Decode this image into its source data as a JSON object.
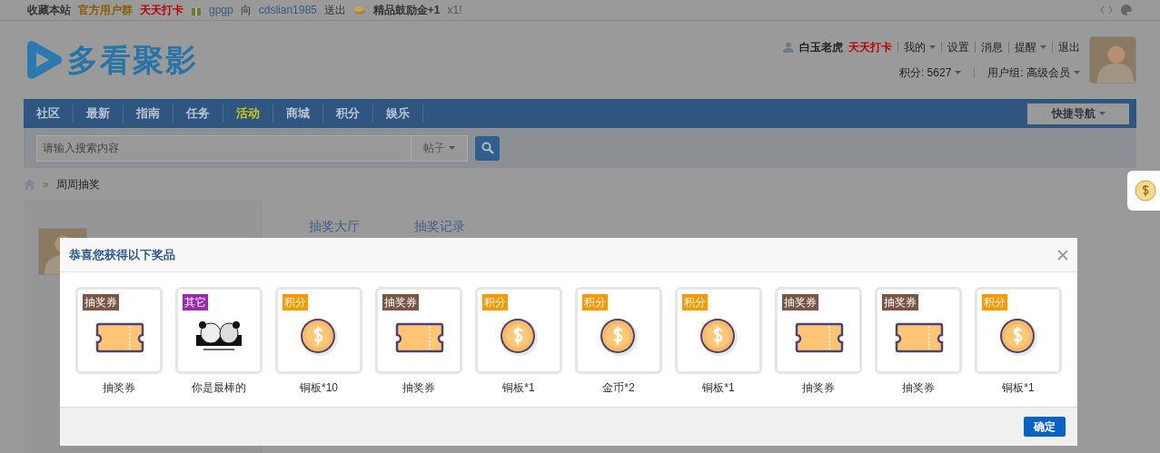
{
  "top_bar": {
    "items": [
      {
        "text": "收藏本站",
        "kind": "plain"
      },
      {
        "text": "官方用户群",
        "kind": "orange"
      },
      {
        "text": "天天打卡",
        "kind": "red"
      }
    ],
    "notice": {
      "from": "gpgp",
      "verb": "向",
      "to": "cdslian1985",
      "sent": "送出",
      "prize": "精品鼓励金+1",
      "count": "x1!"
    }
  },
  "logo": {
    "text": "多看聚影"
  },
  "user": {
    "name": "白玉老虎",
    "checkin": "天天打卡",
    "links": [
      {
        "text": "我的",
        "dropdown": true
      },
      {
        "text": "设置",
        "dropdown": false
      },
      {
        "text": "消息",
        "dropdown": false
      },
      {
        "text": "提醒",
        "dropdown": true
      },
      {
        "text": "退出",
        "dropdown": false
      }
    ],
    "points": "积分: 5627",
    "group": "用户组: 高级会员"
  },
  "nav": {
    "items": [
      {
        "label": "社区",
        "selected": false
      },
      {
        "label": "最新",
        "selected": false
      },
      {
        "label": "指南",
        "selected": false
      },
      {
        "label": "任务",
        "selected": false
      },
      {
        "label": "活动",
        "selected": true
      },
      {
        "label": "商城",
        "selected": false
      },
      {
        "label": "积分",
        "selected": false
      },
      {
        "label": "娱乐",
        "selected": false
      }
    ],
    "quick_nav": "快捷导航"
  },
  "search": {
    "placeholder": "请输入搜索内容",
    "scope": "帖子"
  },
  "breadcrumb": {
    "separator": "»",
    "current": "周周抽奖"
  },
  "tabs": [
    {
      "label": "抽奖大厅"
    },
    {
      "label": "抽奖记录"
    }
  ],
  "dialog": {
    "title": "恭喜您获得以下奖品",
    "confirm": "确定",
    "prizes": [
      {
        "tag": "抽奖券",
        "color": "#7a5546",
        "kind": "ticket",
        "label": "抽奖券"
      },
      {
        "tag": "其它",
        "color": "#9c27b0",
        "kind": "picture",
        "label": "你是最棒的"
      },
      {
        "tag": "积分",
        "color": "#ff9800",
        "kind": "coin",
        "label": "铜板*10"
      },
      {
        "tag": "抽奖券",
        "color": "#7a5546",
        "kind": "ticket",
        "label": "抽奖券"
      },
      {
        "tag": "积分",
        "color": "#ff9800",
        "kind": "coin",
        "label": "铜板*1"
      },
      {
        "tag": "积分",
        "color": "#ff9800",
        "kind": "coin",
        "label": "金币*2"
      },
      {
        "tag": "积分",
        "color": "#ff9800",
        "kind": "coin",
        "label": "铜板*1"
      },
      {
        "tag": "抽奖券",
        "color": "#7a5546",
        "kind": "ticket",
        "label": "抽奖券"
      },
      {
        "tag": "抽奖券",
        "color": "#7a5546",
        "kind": "ticket",
        "label": "抽奖券"
      },
      {
        "tag": "积分",
        "color": "#ff9800",
        "kind": "coin",
        "label": "铜板*1"
      }
    ]
  }
}
